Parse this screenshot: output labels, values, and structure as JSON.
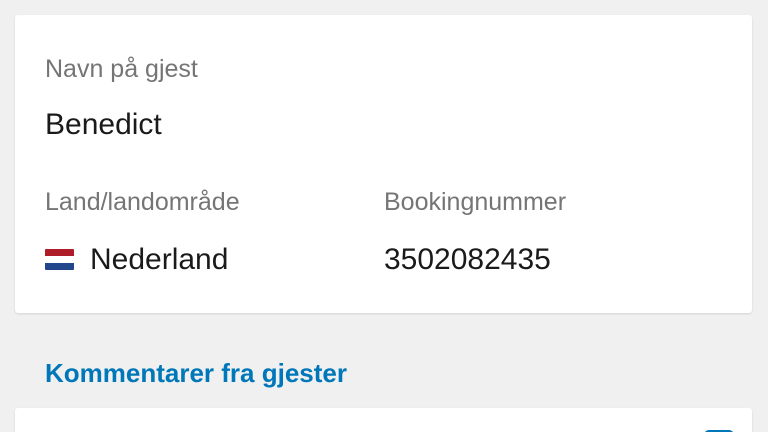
{
  "guest_card": {
    "name_label": "Navn på gjest",
    "name_value": "Benedict",
    "country_label": "Land/landområde",
    "country_value": "Nederland",
    "country_flag_colors": [
      "#ae1c28",
      "#ffffff",
      "#21468b"
    ],
    "booking_label": "Bookingnummer",
    "booking_value": "3502082435"
  },
  "comments": {
    "title": "Kommentarer fra gjester",
    "accent_color": "#0077b8"
  }
}
